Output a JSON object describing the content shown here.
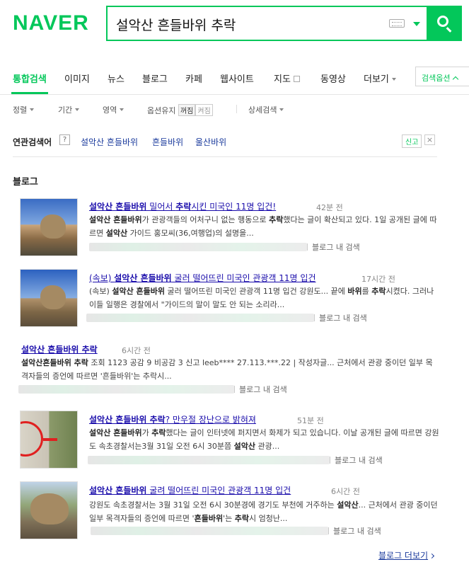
{
  "header": {
    "logo": "NAVER",
    "query": "설악산 흔들바위 추락"
  },
  "tabs": [
    {
      "label": "통합검색",
      "active": true
    },
    {
      "label": "이미지"
    },
    {
      "label": "뉴스"
    },
    {
      "label": "블로그"
    },
    {
      "label": "카페"
    },
    {
      "label": "웹사이트"
    },
    {
      "label": "지도"
    },
    {
      "label": "동영상"
    },
    {
      "label": "더보기"
    }
  ],
  "search_options_label": "검색옵션",
  "filters": {
    "sort": "정렬",
    "period": "기간",
    "area": "영역",
    "keep_option": "옵션유지",
    "off": "꺼짐",
    "on": "켜짐",
    "detail": "상세검색"
  },
  "related": {
    "title": "연관검색어",
    "help": "?",
    "items": [
      "설악산 흔들바위",
      "흔들바위",
      "울산바위"
    ],
    "report": "신고",
    "close": "×"
  },
  "blog_section": {
    "title": "블로그",
    "blog_search_label": "블로그 내 검색",
    "more_label": "블로그 더보기",
    "items": [
      {
        "title_pre": "",
        "title_bold": "설악산 흔들바위",
        "title_mid": " 밀어서 ",
        "title_bold2": "추락",
        "title_post": "시킨 미국인 11명 입건!",
        "time": "42분 전",
        "desc_html": "<b>설악산 흔들바위</b>가 관광객들의 어처구니 없는 행동으로 <b>추락</b>했다는 글이 확산되고 있다. 1일 공개된 글에 따르면 <b>설악산</b> 가이드 홍모씨(36,여행업)의 설명을..."
      },
      {
        "title_pre": "(속보) ",
        "title_bold": "설악산 흔들바위",
        "title_mid": " 굴러 떨어뜨린 미국인 관광객 11명 입건",
        "title_bold2": "",
        "title_post": "",
        "time": "17시간 전",
        "desc_html": "(속보) <b>설악산 흔들바위</b> 굴러 떨어뜨린 미국인 관광객 11명 입건 강원도... 끝에 <b>바위</b>를 <b>추락</b>시켰다. 그러나 이들 일행은 경찰에서 \"가이드의 말이 말도 안 되는 소리라..."
      },
      {
        "title_pre": "",
        "title_bold": "설악산 흔들바위 추락",
        "title_mid": "",
        "title_bold2": "",
        "title_post": "",
        "time": "6시간 전",
        "desc_html": "<b>설악산흔들바위 추락</b> 조회 1123 공감 9 비공감 3 신고 leeb**** 27.113.***.22 | 작성자글... 근처에서 관광 중이던 일부 목격자들의 증언에 따르면 '흔들바위'는 추락시..."
      },
      {
        "title_pre": "",
        "title_bold": "설악산 흔들바위 추락",
        "title_mid": "? 만우절 장난으로 밝혀져",
        "title_bold2": "",
        "title_post": "",
        "time": "51분 전",
        "desc_html": "<b>설악산 흔들바위</b>가 <b>추락</b>했다는 글이 인터넷에 퍼지면서 화제가 되고 있습니다. 이날 공개된 글에 따르면 강원도 속초경찰서는3월 31일 오전 6시 30분쯤 <b>설악산</b> 관광..."
      },
      {
        "title_pre": "",
        "title_bold": "설악산 흔들바위",
        "title_mid": " 굴려 떨어뜨린 미국인 관광객 11명 입건",
        "title_bold2": "",
        "title_post": "",
        "time": "6시간 전",
        "desc_html": "강원도 속초경찰서는 3월 31일 오전 6시 30분경에 경기도 부천에 거주하는 <b>설악산</b>... 근처에서 관광 중이던 일부 목격자들의 증언에 따르면 '<b>흔들바위</b>'는 <b>추락</b>시 엄청난..."
      }
    ]
  }
}
